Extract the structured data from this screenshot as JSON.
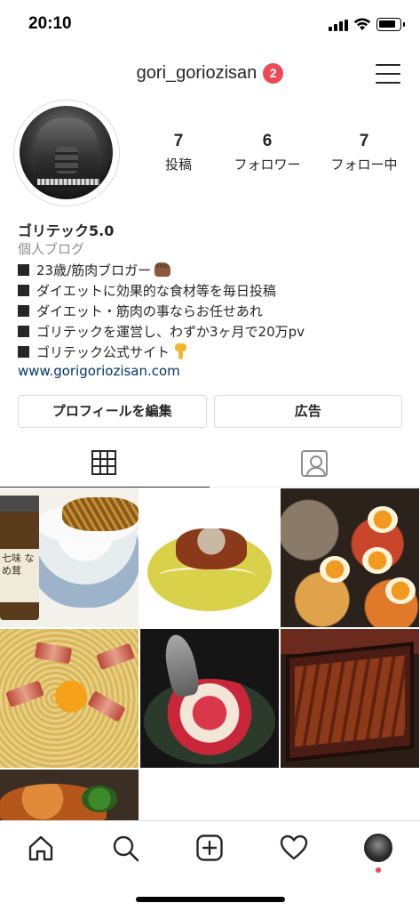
{
  "status_bar": {
    "time": "20:10"
  },
  "header": {
    "username": "gori_goriozisan",
    "notification_count": "2"
  },
  "stats": [
    {
      "value": "7",
      "label": "投稿"
    },
    {
      "value": "6",
      "label": "フォロワー"
    },
    {
      "value": "7",
      "label": "フォロー中"
    }
  ],
  "bio": {
    "name": "ゴリテック5.0",
    "category": "個人ブログ",
    "lines": [
      "23歳/筋肉ブロガー",
      "ダイエットに効果的な食材等を毎日投稿",
      "ダイエット・筋肉の事ならお任せあれ",
      "ゴリテックを運営し、わずか3ヶ月で20万pv",
      "ゴリテック公式サイト"
    ],
    "link": "www.gorigoriozisan.com"
  },
  "buttons": {
    "edit_profile": "プロフィールを編集",
    "ads": "広告"
  },
  "grid": {
    "jar_label": "七味 なめ茸"
  },
  "colors": {
    "badge": "#ed4956",
    "link": "#003569",
    "secondary_text": "#8e8e8e"
  },
  "icons": {
    "tabs": [
      "grid-icon",
      "tagged-icon"
    ],
    "bottom_nav": [
      "home-icon",
      "search-icon",
      "add-post-icon",
      "heart-icon",
      "profile-avatar"
    ]
  }
}
